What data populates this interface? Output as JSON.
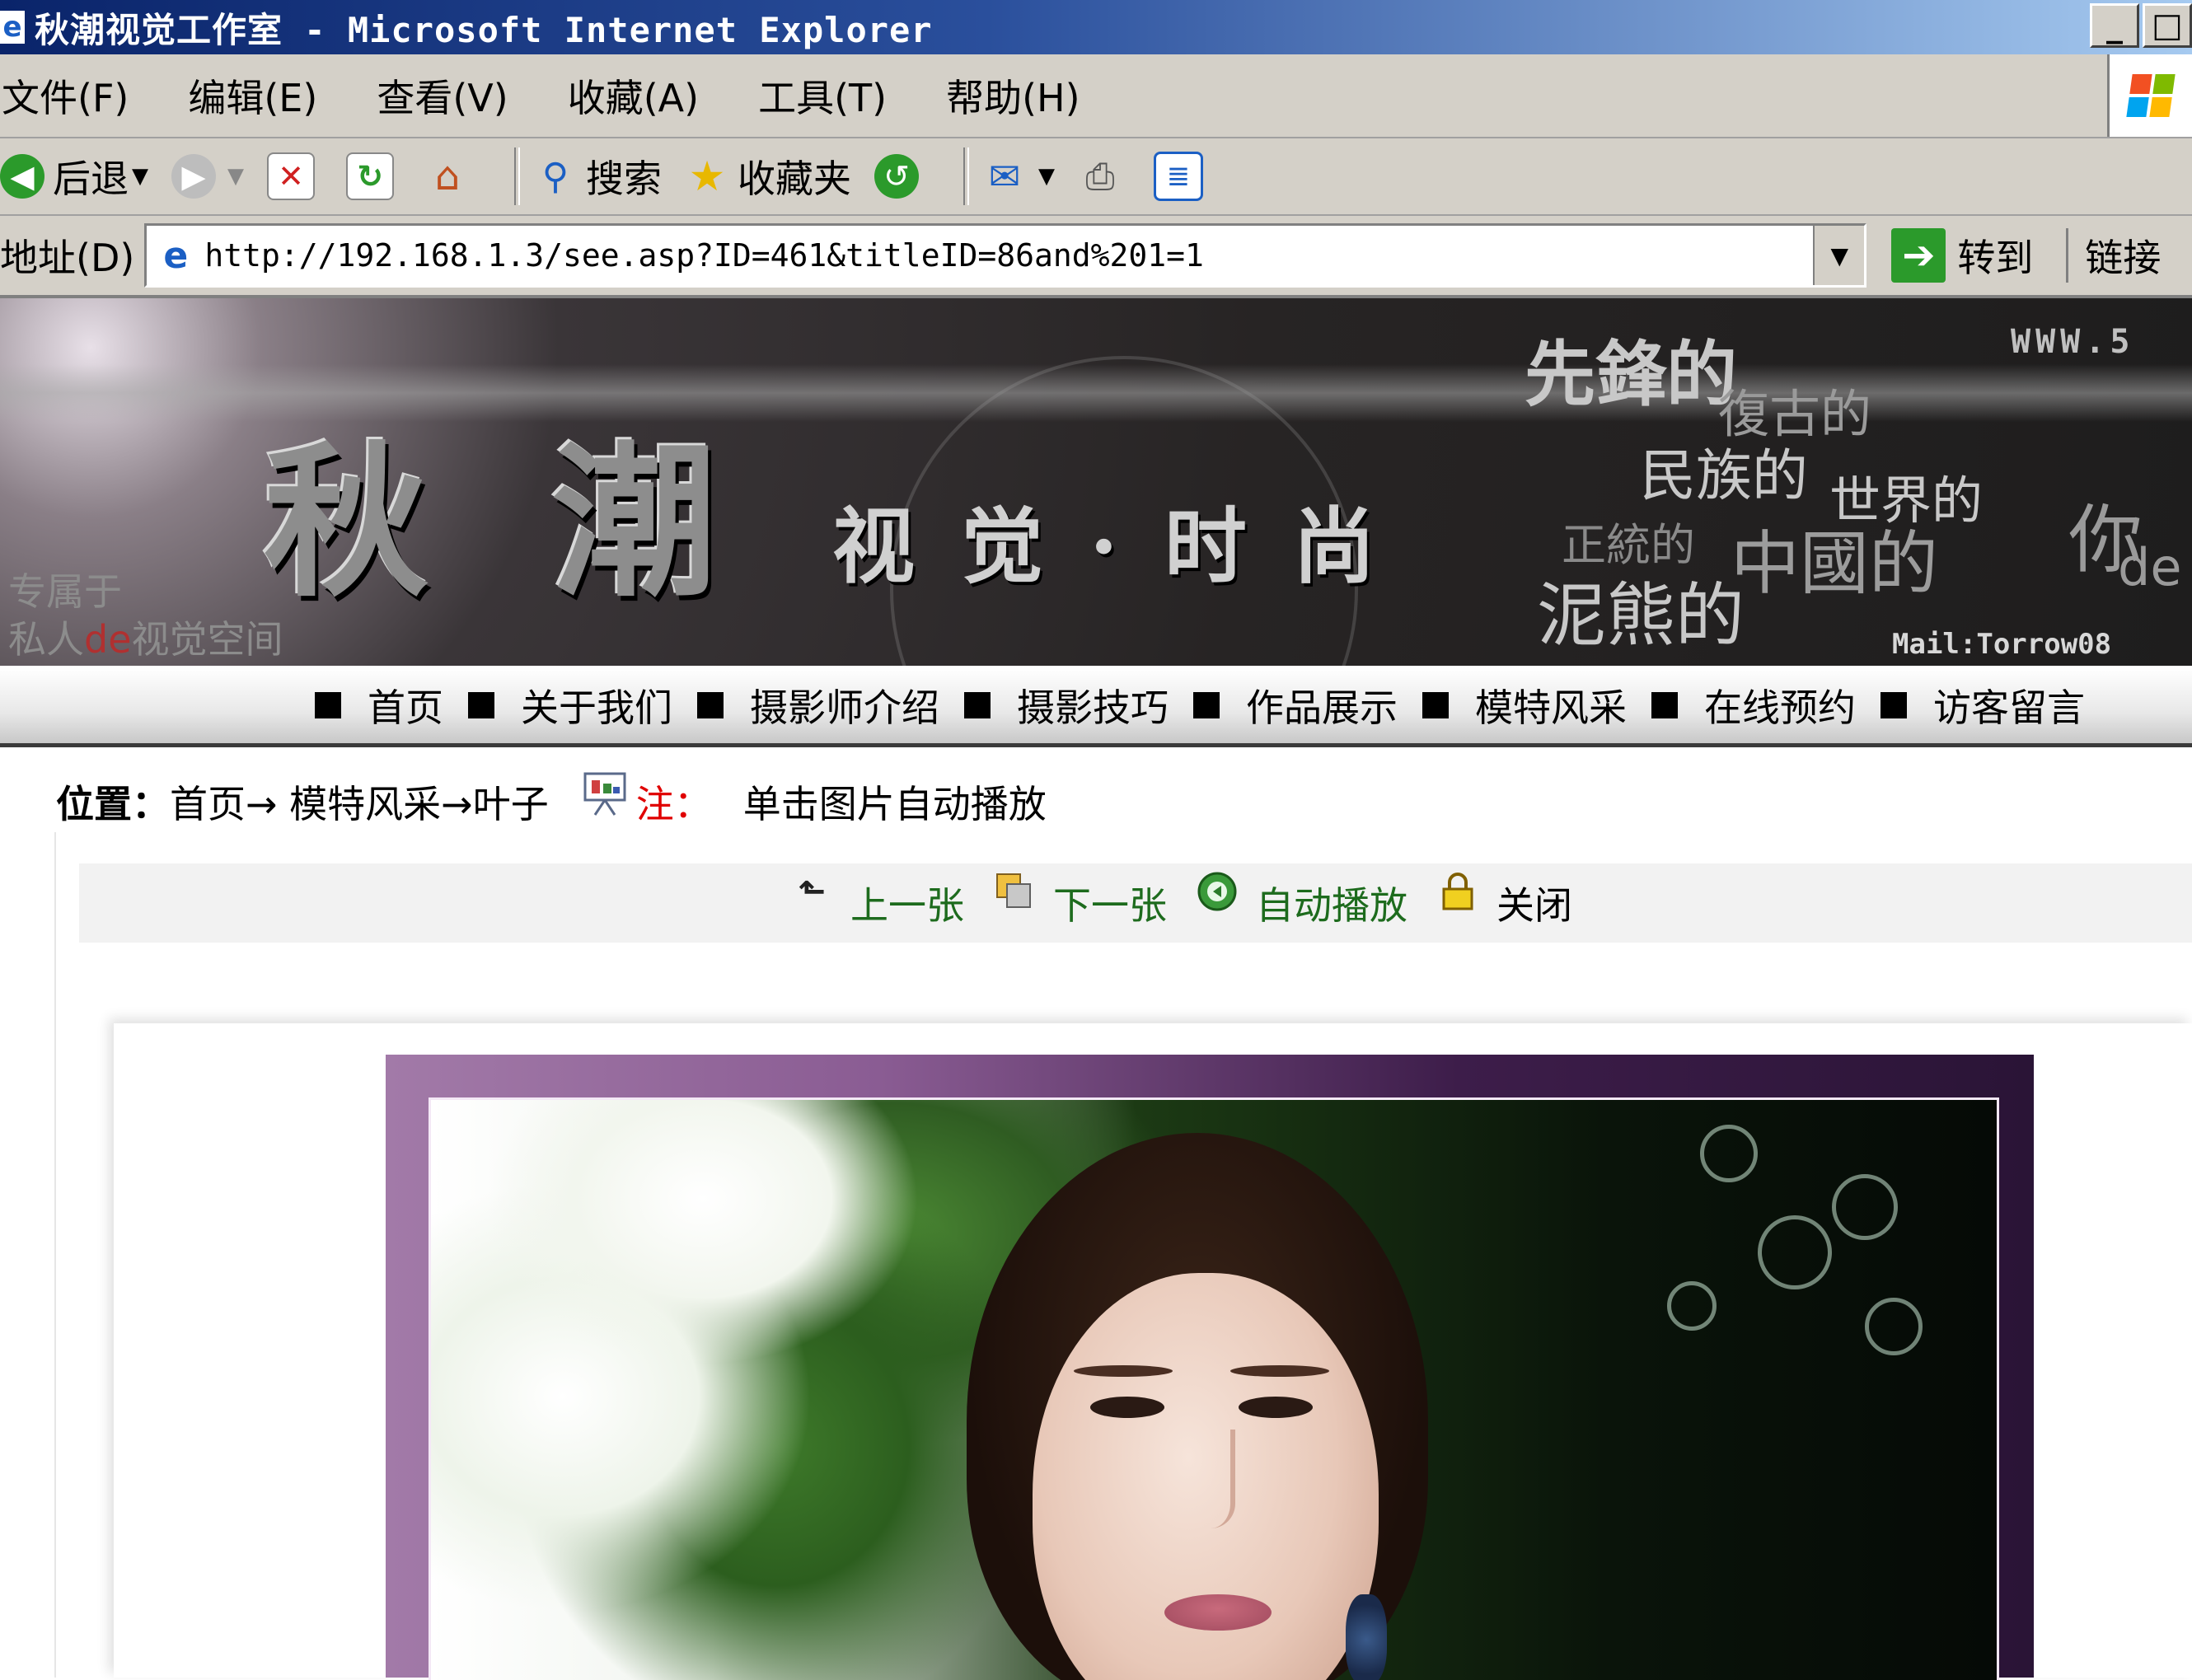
{
  "window": {
    "title": "秋潮视觉工作室 - Microsoft Internet Explorer",
    "icon": "ie-icon",
    "buttons": [
      "minimize",
      "maximize"
    ]
  },
  "menu": [
    "文件(F)",
    "编辑(E)",
    "查看(V)",
    "收藏(A)",
    "工具(T)",
    "帮助(H)"
  ],
  "toolbar": {
    "back": "后退",
    "search": "搜索",
    "favorites": "收藏夹"
  },
  "address": {
    "label": "地址(D)",
    "url": "http://192.168.1.3/see.asp?ID=461&titleID=86and%201=1",
    "go": "转到",
    "links": "链接"
  },
  "banner": {
    "logo": "秋潮",
    "subtitle": "视觉·时尚",
    "side_line1": "专属于",
    "side_line2_a": "私人",
    "side_line2_b": "de",
    "side_line2_c": "视觉空间",
    "words": [
      "先鋒的",
      "復古的",
      "民族的",
      "世界的",
      "正統的",
      "中國的",
      "泥熊的",
      "你",
      "de"
    ],
    "www": "WWW.5",
    "mail": "Mail:Torrow08"
  },
  "nav": [
    "首页",
    "关于我们",
    "摄影师介绍",
    "摄影技巧",
    "作品展示",
    "模特风采",
    "在线预约",
    "访客留言"
  ],
  "breadcrumb": {
    "label": "位置：",
    "path": "首页→ 模特风采→叶子",
    "note_label": "注：",
    "note_text": "单击图片自动播放"
  },
  "controls": {
    "prev": "上一张",
    "next": "下一张",
    "auto": "自动播放",
    "close": "关闭"
  },
  "colors": {
    "title_bar": "#0a246a",
    "chrome": "#d4d0c8",
    "link_green": "#1d6b1d",
    "note_red": "#e00000",
    "photo_frame": "#8a5c93"
  }
}
